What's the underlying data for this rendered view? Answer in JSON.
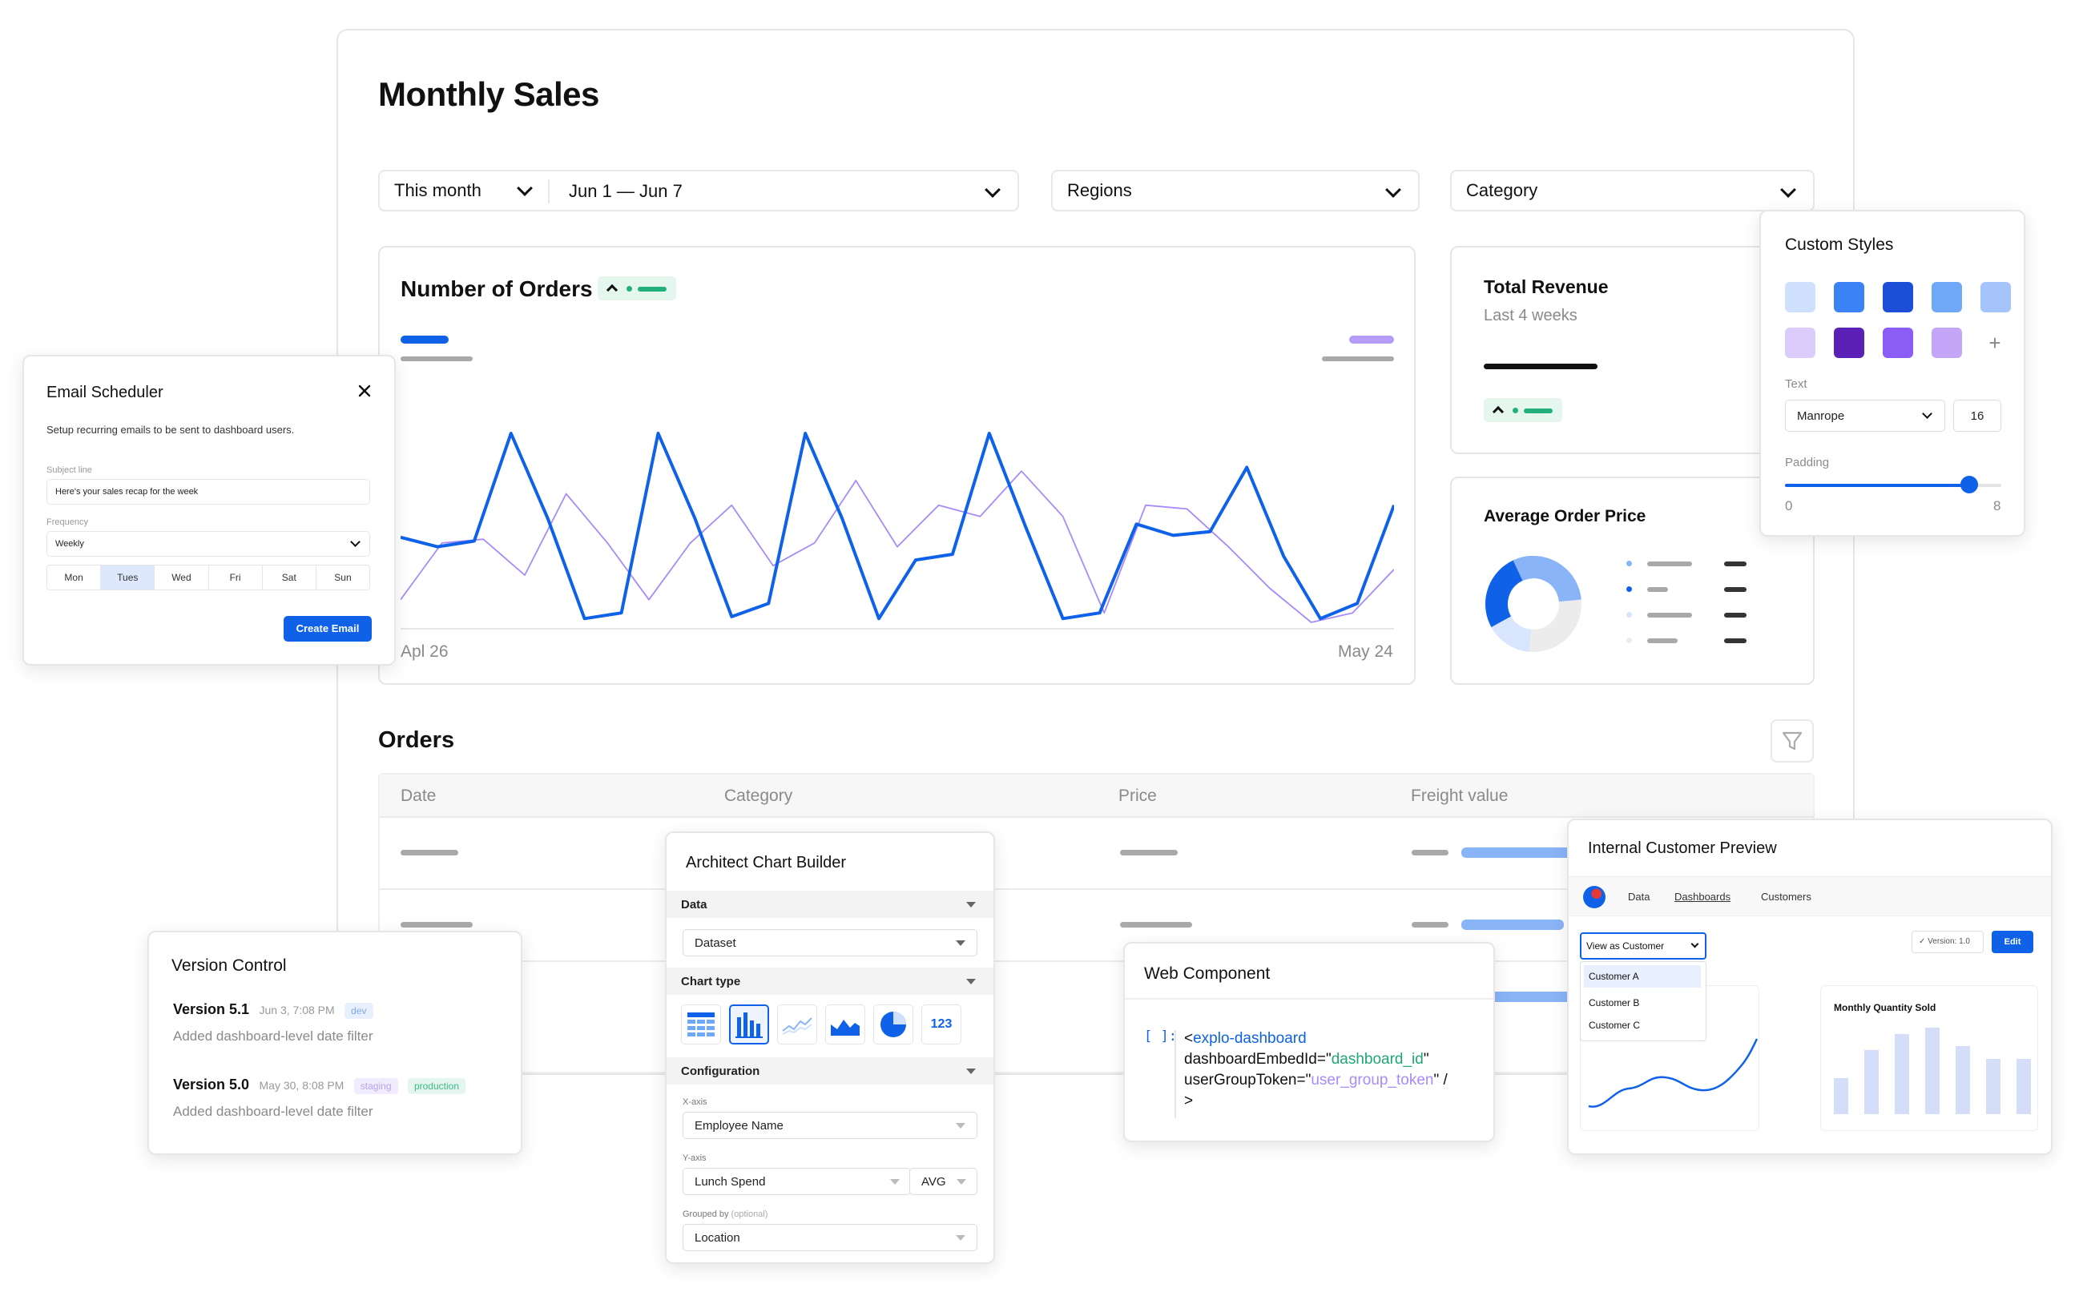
{
  "dashboard": {
    "title": "Monthly Sales",
    "filters": {
      "period": "This month",
      "date_range": "Jun 1 — Jun 7",
      "regions": "Regions",
      "category": "Category"
    },
    "orders_chart": {
      "title": "Number of Orders",
      "x_start": "Apl 26",
      "x_end": "May 24"
    },
    "total_revenue": {
      "title": "Total Revenue",
      "subtitle": "Last 4 weeks"
    },
    "avg_order": {
      "title": "Average Order Price"
    },
    "orders_table": {
      "title": "Orders",
      "columns": [
        "Date",
        "Category",
        "Price",
        "Freight value"
      ]
    }
  },
  "chart_data": {
    "type": "line",
    "title": "Number of Orders",
    "x_tick_labels": [
      "Apl 26",
      "May 24"
    ],
    "ylim": [
      0,
      100
    ],
    "grid": false,
    "series": [
      {
        "color": "#0f62e8",
        "values": [
          45,
          40,
          43,
          100,
          55,
          2,
          5,
          100,
          55,
          3,
          10,
          100,
          55,
          2,
          33,
          36,
          100,
          50,
          2,
          5,
          52,
          46,
          48,
          82,
          35,
          2,
          10,
          62
        ]
      },
      {
        "color": "#a78bfa",
        "values": [
          12,
          42,
          44,
          25,
          68,
          42,
          12,
          42,
          62,
          30,
          42,
          75,
          40,
          62,
          56,
          80,
          56,
          5,
          62,
          60,
          40,
          18,
          0,
          5,
          28
        ]
      }
    ]
  },
  "email_scheduler": {
    "title": "Email Scheduler",
    "description": "Setup recurring emails to be sent to dashboard users.",
    "subject_label": "Subject line",
    "subject_value": "Here's your sales recap for the week",
    "frequency_label": "Frequency",
    "frequency_value": "Weekly",
    "days": [
      "Mon",
      "Tues",
      "Wed",
      "Fri",
      "Sat",
      "Sun"
    ],
    "selected_day": "Tues",
    "submit_label": "Create Email"
  },
  "custom_styles": {
    "title": "Custom Styles",
    "swatches": [
      "#cfe0fd",
      "#3b82f6",
      "#1d4ed8",
      "#6ea8f7",
      "#a5c4fb",
      "#dcccfb",
      "#5b21b6",
      "#8b5cf6",
      "#c4a6f8"
    ],
    "text_label": "Text",
    "font_value": "Manrope",
    "font_size": "16",
    "padding_label": "Padding",
    "padding_min": "0",
    "padding_max": "8",
    "padding_level": 0.85
  },
  "version_control": {
    "title": "Version Control",
    "versions": [
      {
        "name": "Version 5.1",
        "date": "Jun 3, 7:08 PM",
        "tags": [
          "dev"
        ],
        "note": "Added dashboard-level date filter"
      },
      {
        "name": "Version 5.0",
        "date": "May 30, 8:08 PM",
        "tags": [
          "staging",
          "production"
        ],
        "note": "Added dashboard-level date filter"
      }
    ]
  },
  "chart_builder": {
    "title": "Architect Chart Builder",
    "data_section": "Data",
    "dataset": "Dataset",
    "chart_type_section": "Chart type",
    "number_icon_label": "123",
    "config_section": "Configuration",
    "x_axis_label": "X-axis",
    "x_axis_value": "Employee Name",
    "y_axis_label": "Y-axis",
    "y_axis_value": "Lunch Spend",
    "y_axis_agg": "AVG",
    "grouped_label": "Grouped by",
    "grouped_optional": "(optional)",
    "grouped_value": "Location"
  },
  "web_component": {
    "title": "Web Component",
    "bracket": "[ ]:",
    "tag_open": "<",
    "tag_name": "explo-dashboard",
    "attr1": "dashboardEmbedId=",
    "val1": "dashboard_id",
    "attr2": "userGroupToken=",
    "val2": "user_group_token",
    "self_close": " /",
    "close": ">",
    "quote": "\""
  },
  "customer_preview": {
    "title": "Internal Customer Preview",
    "nav": [
      "Data",
      "Dashboards",
      "Customers"
    ],
    "view_as": "View as Customer",
    "customers": [
      "Customer A",
      "Customer B",
      "Customer C"
    ],
    "version_label": "Version: 1.0",
    "edit_label": "Edit",
    "chart2_title": "Monthly Quantity Sold",
    "bars": [
      28,
      50,
      63,
      68,
      53,
      43,
      43
    ]
  },
  "colors": {
    "accent": "#0f62e8",
    "purple": "#a78bfa",
    "green": "#22b07d"
  }
}
